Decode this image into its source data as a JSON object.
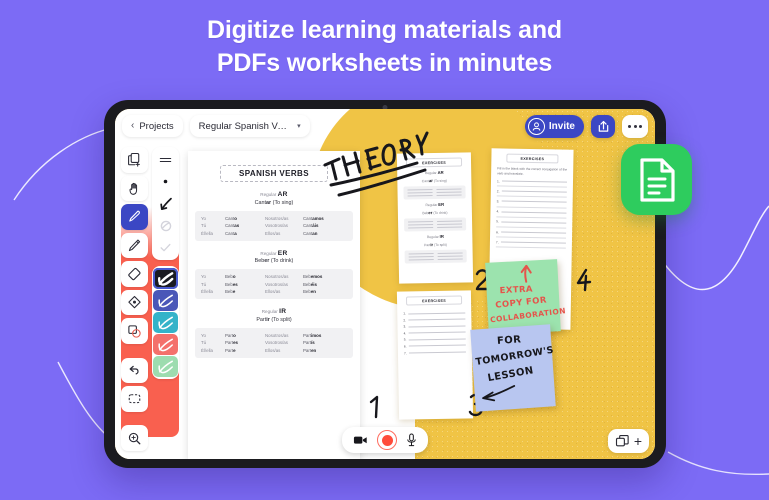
{
  "page": {
    "background_color": "#7C6BF5",
    "headline_line1": "Digitize learning materials and",
    "headline_line2": "PDFs worksheets in minutes"
  },
  "app_icon": {
    "name": "document-app-icon",
    "color": "#2ECC5E"
  },
  "topbar": {
    "back_label": "Projects",
    "back_chevron": "‹",
    "project_title": "Regular Spanish Ver..",
    "caret": "▾",
    "invite_label": "Invite",
    "share_icon": "share-icon",
    "more_icon": "more-options-icon"
  },
  "toolbar": {
    "accent_color": "#F9604F",
    "selected_color": "#3B47C4",
    "tools": [
      {
        "name": "add-page-tool",
        "label": "Add page"
      },
      {
        "name": "hand-tool",
        "label": "Hand"
      },
      {
        "name": "pen-tool",
        "label": "Pen",
        "selected": true
      },
      {
        "name": "pencil-tool",
        "label": "Pencil"
      },
      {
        "name": "eraser-tool",
        "label": "Eraser"
      },
      {
        "name": "fill-tool",
        "label": "Fill"
      },
      {
        "name": "shapes-tool",
        "label": "Shapes"
      },
      {
        "name": "undo-tool",
        "label": "Undo"
      },
      {
        "name": "select-tool",
        "label": "Select"
      },
      {
        "name": "zoom-tool",
        "label": "Zoom"
      }
    ],
    "stroke_sizes": [
      {
        "name": "stroke-menu",
        "label": "Menu"
      },
      {
        "name": "stroke-dot",
        "label": "Thin"
      },
      {
        "name": "stroke-medium",
        "label": "Medium"
      },
      {
        "name": "stroke-thick",
        "label": "Thick"
      },
      {
        "name": "stroke-check",
        "label": "Check"
      }
    ],
    "swatches": [
      {
        "name": "swatch-black",
        "color": "#1B1B22",
        "active": true
      },
      {
        "name": "swatch-indigo",
        "color": "#4A57B8",
        "active": false
      },
      {
        "name": "swatch-cyan",
        "color": "#34B3C9",
        "active": false
      },
      {
        "name": "swatch-coral",
        "color": "#F4706B",
        "active": false
      },
      {
        "name": "swatch-mint",
        "color": "#9DDCAF",
        "active": false
      }
    ]
  },
  "document": {
    "title": "SPANISH VERBS",
    "sections": [
      {
        "kind_prefix": "Regular",
        "kind": "AR",
        "verb": "Cant",
        "verb_suffix": "ar",
        "meaning": "(To sing)",
        "rows": [
          {
            "p1": "Yo",
            "s1": "Cant",
            "e1": "o",
            "p2": "Nosotros/as",
            "s2": "Cant",
            "e2": "amos"
          },
          {
            "p1": "Tú",
            "s1": "Cant",
            "e1": "as",
            "p2": "Vosotros/as",
            "s2": "Cant",
            "e2": "áis"
          },
          {
            "p1": "Él/ella",
            "s1": "Cant",
            "e1": "a",
            "p2": "Ellos/as",
            "s2": "Cant",
            "e2": "an"
          }
        ]
      },
      {
        "kind_prefix": "Regular",
        "kind": "ER",
        "verb": "Beb",
        "verb_suffix": "er",
        "meaning": "(To drink)",
        "rows": [
          {
            "p1": "Yo",
            "s1": "Beb",
            "e1": "o",
            "p2": "Nosotros/as",
            "s2": "Beb",
            "e2": "emos"
          },
          {
            "p1": "Tú",
            "s1": "Beb",
            "e1": "es",
            "p2": "Vosotros/as",
            "s2": "Beb",
            "e2": "éis"
          },
          {
            "p1": "Él/ella",
            "s1": "Beb",
            "e1": "e",
            "p2": "Ellos/as",
            "s2": "Beb",
            "e2": "en"
          }
        ]
      },
      {
        "kind_prefix": "Regular",
        "kind": "IR",
        "verb": "Part",
        "verb_suffix": "ir",
        "meaning": "(To split)",
        "rows": [
          {
            "p1": "Yo",
            "s1": "Part",
            "e1": "o",
            "p2": "Nosotros/as",
            "s2": "Part",
            "e2": "imos"
          },
          {
            "p1": "Tú",
            "s1": "Part",
            "e1": "es",
            "p2": "Vosotros/as",
            "s2": "Part",
            "e2": "ís"
          },
          {
            "p1": "Él/ella",
            "s1": "Part",
            "e1": "e",
            "p2": "Ellos/as",
            "s2": "Part",
            "e2": "en"
          }
        ]
      }
    ]
  },
  "worksheets": [
    {
      "name": "worksheet-exercises-1",
      "header": "EXERCISES",
      "blocks": [
        {
          "kind_prefix": "Regular",
          "kind": "AR",
          "verb": "Cant",
          "verb_suffix": "ar",
          "meaning": "(To sing)"
        },
        {
          "kind_prefix": "Regular",
          "kind": "ER",
          "verb": "Beb",
          "verb_suffix": "er",
          "meaning": "(To drink)"
        },
        {
          "kind_prefix": "Regular",
          "kind": "IR",
          "verb": "Part",
          "verb_suffix": "ir",
          "meaning": "(To split)"
        }
      ]
    },
    {
      "name": "worksheet-exercises-2",
      "header": "EXERCISES",
      "intro": "Fill in the blank with the correct conjugation of the verb and translate.",
      "questions": [
        "1.",
        "2.",
        "3.",
        "4.",
        "5.",
        "6.",
        "7."
      ]
    }
  ],
  "annotations": {
    "theory_label": "THEORY",
    "numbers": [
      "1",
      "2",
      "3",
      "4"
    ],
    "sticky_green": {
      "name": "sticky-note-green",
      "color": "#9CE3AE",
      "line1": "EXTRA",
      "line2": "COPY FOR",
      "line3": "COLLABORATION",
      "arrow": "arrow-up-icon"
    },
    "sticky_blue": {
      "name": "sticky-note-blue",
      "color": "#B8C6F0",
      "line1": "FOR",
      "line2": "TOMORROW'S",
      "line3": "LESSON",
      "arrow": "arrow-left-icon"
    }
  },
  "bottombar": {
    "video_icon": "video-camera-icon",
    "record_icon": "record-button",
    "mic_icon": "microphone-icon",
    "pages_icon": "pages-icon",
    "add_label": "+"
  }
}
